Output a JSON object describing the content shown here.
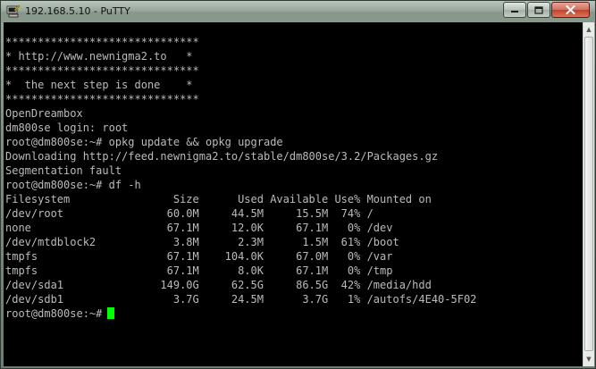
{
  "window": {
    "title": "192.168.5.10 - PuTTY"
  },
  "icons": {
    "app": "putty-icon",
    "minimize": "minimize-icon",
    "maximize": "maximize-icon",
    "close": "close-icon",
    "scroll_up": "scroll-up-icon",
    "scroll_down": "scroll-down-icon"
  },
  "colors": {
    "terminal_bg": "#000000",
    "terminal_fg": "#bbbbbb",
    "cursor": "#00ff00"
  },
  "terminal": {
    "lines": [
      "******************************",
      "* http://www.newnigma2.to   *",
      "******************************",
      "*  the next step is done    *",
      "******************************",
      "OpenDreambox",
      "dm800se login: root",
      "root@dm800se:~# opkg update && opkg upgrade",
      "Downloading http://feed.newnigma2.to/stable/dm800se/3.2/Packages.gz",
      "Segmentation fault",
      "root@dm800se:~# df -h",
      "Filesystem                Size      Used Available Use% Mounted on",
      "/dev/root                60.0M     44.5M     15.5M  74% /",
      "none                     67.1M     12.0K     67.1M   0% /dev",
      "/dev/mtdblock2            3.8M      2.3M      1.5M  61% /boot",
      "tmpfs                    67.1M    104.0K     67.0M   0% /var",
      "tmpfs                    67.1M      8.0K     67.1M   0% /tmp",
      "/dev/sda1               149.0G     62.5G     86.5G  42% /media/hdd",
      "/dev/sdb1                 3.7G     24.5M      3.7G   1% /autofs/4E40-5F02"
    ],
    "prompt": "root@dm800se:~#"
  }
}
